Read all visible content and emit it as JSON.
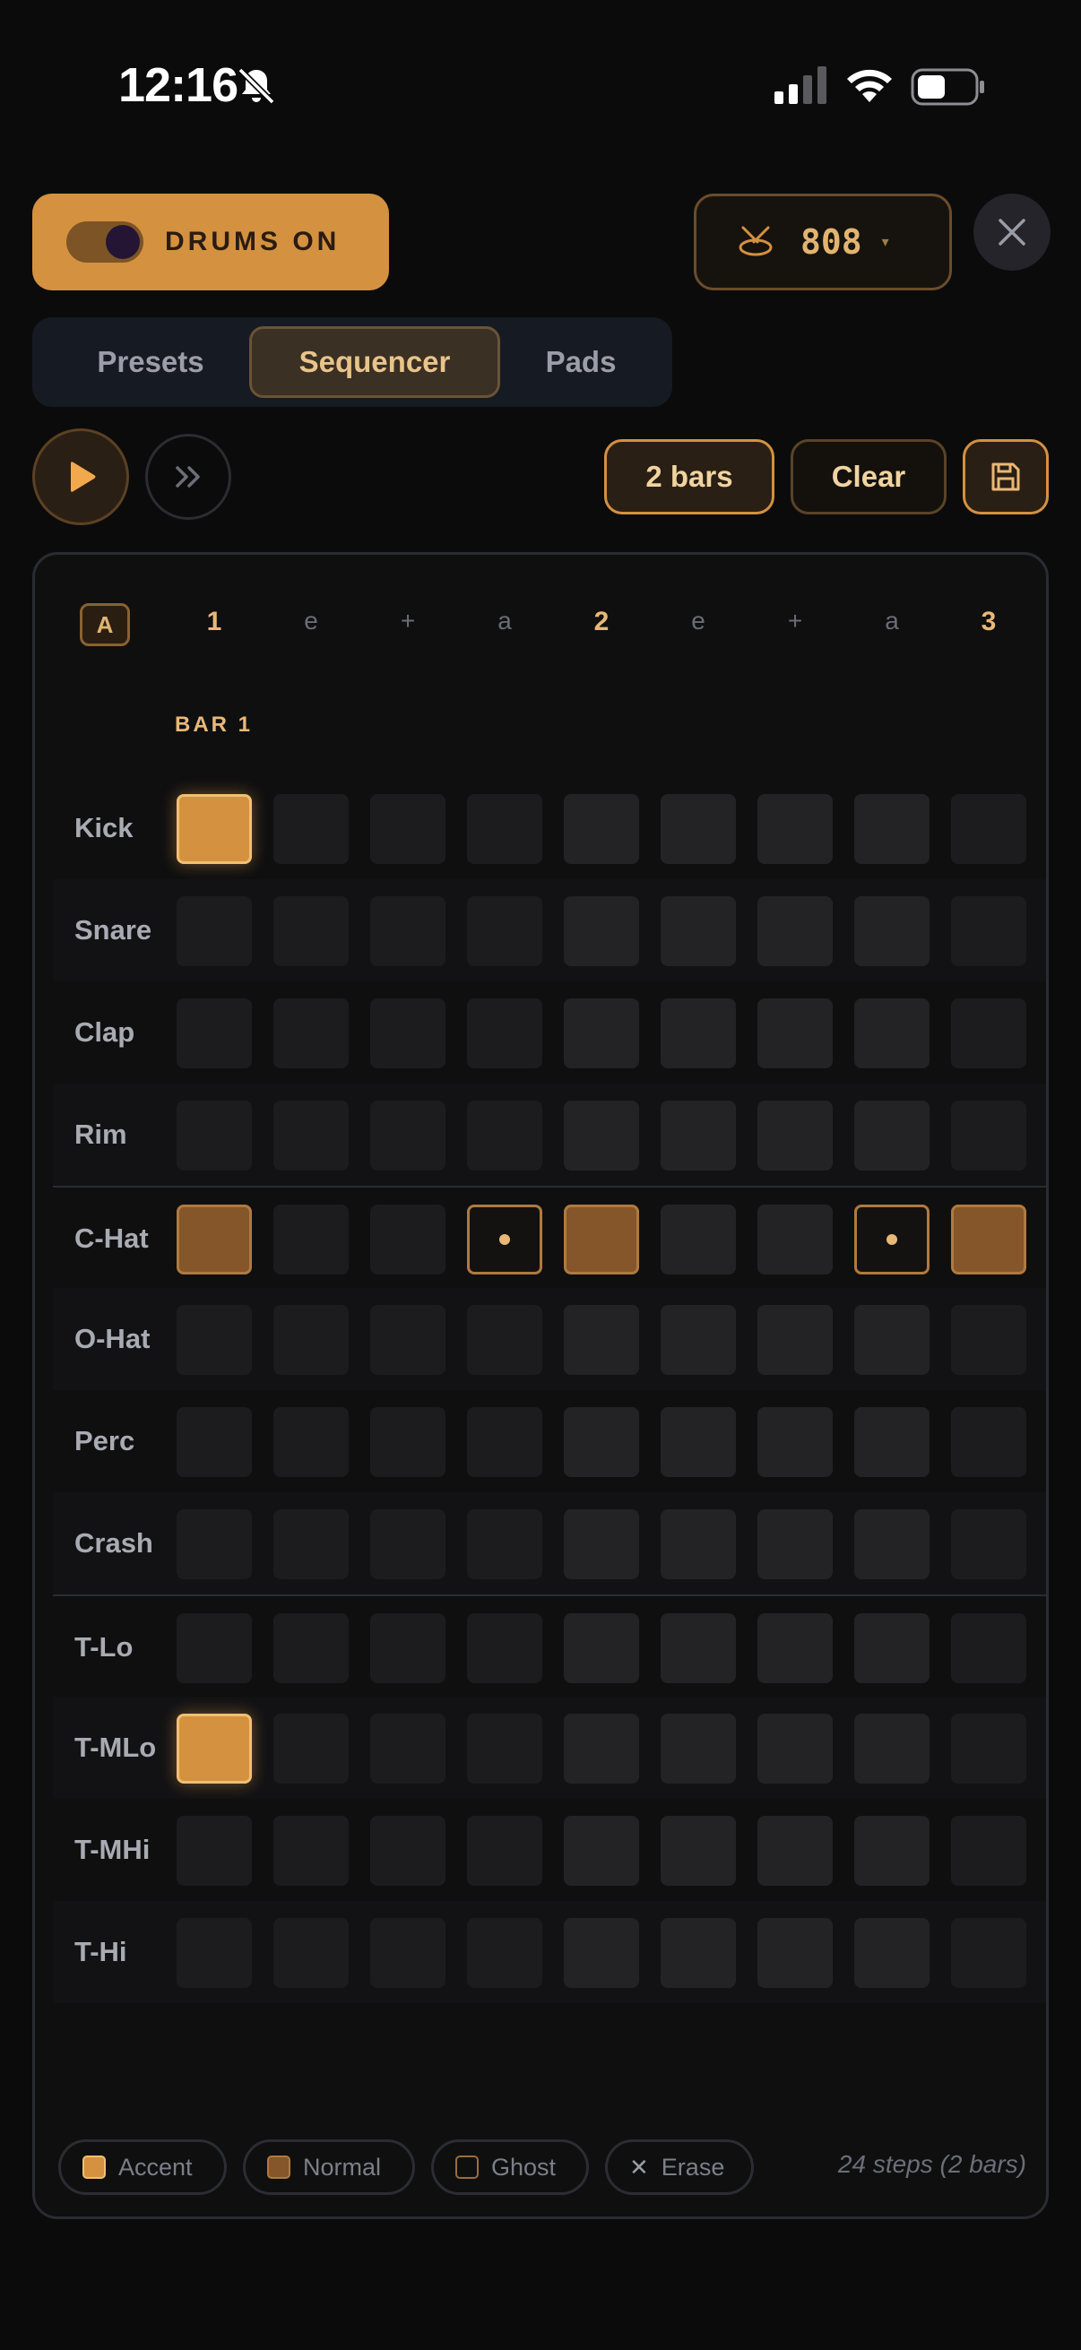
{
  "status": {
    "time": "12:16"
  },
  "header": {
    "drums_toggle_label": "DRUMS ON",
    "kit_name": "808",
    "kit_caret": "▾"
  },
  "tabs": [
    {
      "label": "Presets",
      "active": false
    },
    {
      "label": "Sequencer",
      "active": true
    },
    {
      "label": "Pads",
      "active": false
    }
  ],
  "transport": {
    "bars_label": "2 bars",
    "clear_label": "Clear"
  },
  "grid": {
    "bar_badge": "A",
    "bar_title": "BAR 1",
    "beat_labels": [
      "1",
      "e",
      "+",
      "a",
      "2",
      "e",
      "+",
      "a",
      "3"
    ],
    "rows": [
      {
        "name": "Kick",
        "steps": [
          "accent",
          "off",
          "off",
          "off",
          "off",
          "off",
          "off",
          "off",
          "off"
        ]
      },
      {
        "name": "Snare",
        "steps": [
          "off",
          "off",
          "off",
          "off",
          "off",
          "off",
          "off",
          "off",
          "off"
        ]
      },
      {
        "name": "Clap",
        "steps": [
          "off",
          "off",
          "off",
          "off",
          "off",
          "off",
          "off",
          "off",
          "off"
        ]
      },
      {
        "name": "Rim",
        "steps": [
          "off",
          "off",
          "off",
          "off",
          "off",
          "off",
          "off",
          "off",
          "off"
        ]
      },
      {
        "name": "C-Hat",
        "steps": [
          "normal",
          "off",
          "off",
          "ghost",
          "normal",
          "off",
          "off",
          "ghost",
          "normal"
        ]
      },
      {
        "name": "O-Hat",
        "steps": [
          "off",
          "off",
          "off",
          "off",
          "off",
          "off",
          "off",
          "off",
          "off"
        ]
      },
      {
        "name": "Perc",
        "steps": [
          "off",
          "off",
          "off",
          "off",
          "off",
          "off",
          "off",
          "off",
          "off"
        ]
      },
      {
        "name": "Crash",
        "steps": [
          "off",
          "off",
          "off",
          "off",
          "off",
          "off",
          "off",
          "off",
          "off"
        ]
      },
      {
        "name": "T-Lo",
        "steps": [
          "off",
          "off",
          "off",
          "off",
          "off",
          "off",
          "off",
          "off",
          "off"
        ]
      },
      {
        "name": "T-MLo",
        "steps": [
          "accent",
          "off",
          "off",
          "off",
          "off",
          "off",
          "off",
          "off",
          "off"
        ]
      },
      {
        "name": "T-MHi",
        "steps": [
          "off",
          "off",
          "off",
          "off",
          "off",
          "off",
          "off",
          "off",
          "off"
        ]
      },
      {
        "name": "T-Hi",
        "steps": [
          "off",
          "off",
          "off",
          "off",
          "off",
          "off",
          "off",
          "off",
          "off"
        ]
      }
    ]
  },
  "legend": {
    "accent": "Accent",
    "normal": "Normal",
    "ghost": "Ghost",
    "erase": "Erase",
    "erase_glyph": "✕",
    "steps_info": "24 steps (2 bars)"
  },
  "colors": {
    "accent": "#d4913f",
    "normal": "#845629",
    "background": "#0b0b0c"
  }
}
